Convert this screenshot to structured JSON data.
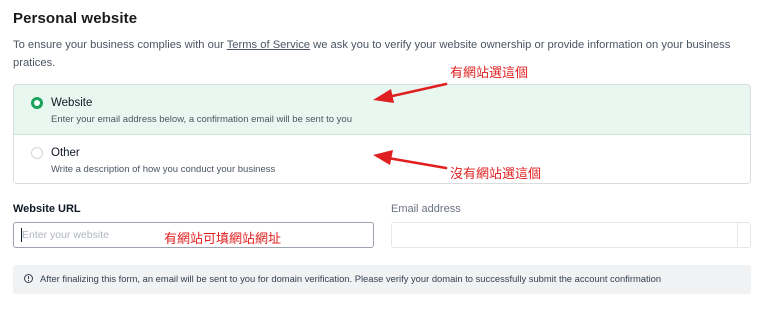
{
  "section": {
    "title": "Personal website",
    "desc_before": "To ensure your business complies with our ",
    "tos_link": "Terms of Service",
    "desc_after": " we ask you to verify your website ownership or provide information on your business pratices."
  },
  "options": [
    {
      "label": "Website",
      "sub": "Enter your email address below, a confirmation email will be sent to you",
      "selected": true
    },
    {
      "label": "Other",
      "sub": "Write a description of how you conduct your business",
      "selected": false
    }
  ],
  "annotations": {
    "website": "有網站選這個",
    "other": "沒有網站選這個",
    "url": "有網站可填網站網址"
  },
  "form": {
    "url_label": "Website URL",
    "url_placeholder": "Enter your website",
    "url_value": "",
    "email_label": "Email address",
    "email_value": ""
  },
  "notice": {
    "icon": "info-icon",
    "text": "After finalizing this form, an email will be sent to you for domain verification. Please verify your domain to successfully submit the account confirmation"
  },
  "colors": {
    "accent": "#1aa35a",
    "selected_bg": "#e8f7ef",
    "annotation": "#e02020"
  }
}
